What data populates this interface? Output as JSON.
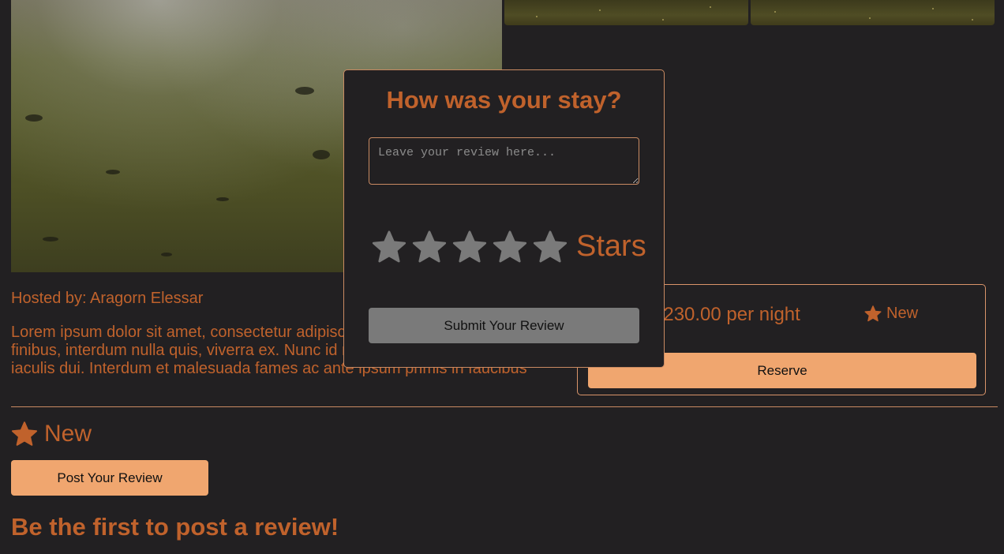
{
  "listing": {
    "hosted_by": "Hosted by: Aragorn Elessar",
    "description_lines": [
      "Lorem ipsum dolor sit amet, consectetur adipiscing elit. Sed a",
      "finibus, interdum nulla quis, viverra ex. Nunc id massa",
      "iaculis dui. Interdum et malesuada fames ac ante ipsum primis in faucibus"
    ]
  },
  "booking": {
    "price": "$230.00 per night",
    "rating": "New",
    "reserve_label": "Reserve"
  },
  "reviews": {
    "rating": "New",
    "post_label": "Post Your Review",
    "empty_message": "Be the first to post a review!"
  },
  "modal": {
    "title": "How was your stay?",
    "textarea_placeholder": "Leave your review here...",
    "stars_label": "Stars",
    "submit_label": "Submit Your Review"
  },
  "colors": {
    "accent": "#c0622c",
    "button": "#f0a66f",
    "background": "#222022",
    "star_inactive": "#7a7a7a"
  }
}
